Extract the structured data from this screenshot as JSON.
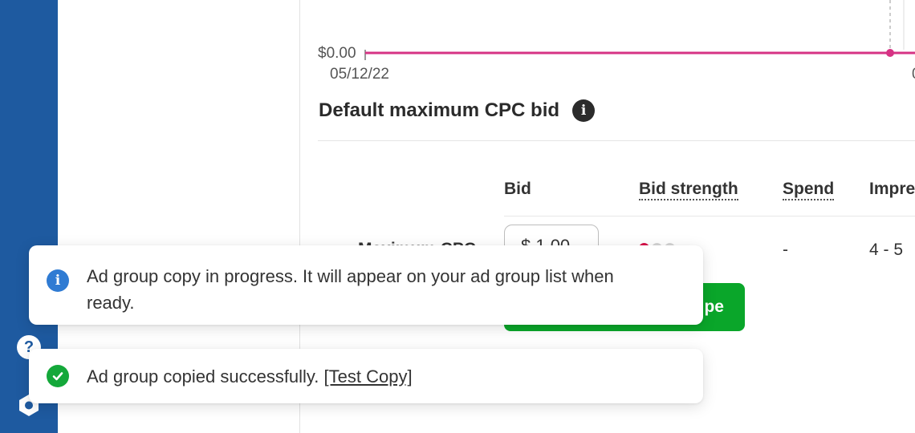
{
  "chart": {
    "y_tick": "$0.00",
    "x_ticks": [
      "05/12/22",
      "0"
    ],
    "line_color": "#d63384"
  },
  "section": {
    "title": "Default maximum CPC bid",
    "info_icon": "info-icon"
  },
  "table": {
    "columns": [
      "Bid",
      "Bid strength",
      "Spend",
      "Impre"
    ],
    "row": {
      "label": "Maximum CPC",
      "bid_value": "$ 1.00",
      "bid_strength_level": 1,
      "bid_strength_max": 3,
      "spend": "-",
      "impressions": "4 - 5"
    }
  },
  "button": {
    "label": "pe",
    "color": "#0aa62a"
  },
  "rail": {
    "help_icon": "question-icon",
    "settings_icon": "hexagon-settings-icon",
    "color": "#1e5aa0"
  },
  "toasts": {
    "info": {
      "text": "Ad group copy in progress. It will appear on your ad group list when ready.",
      "icon": "info-icon"
    },
    "success": {
      "prefix": "Ad group copied successfully. ",
      "link": "[Test Copy]",
      "icon": "check-circle-icon"
    }
  }
}
